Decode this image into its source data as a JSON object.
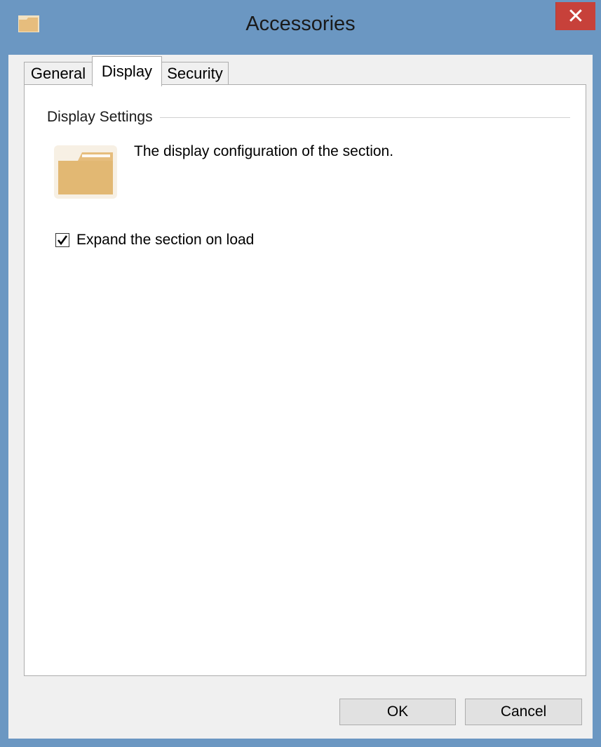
{
  "window": {
    "title": "Accessories",
    "close_symbol": "✕",
    "app_icon": "folder-icon"
  },
  "tabs": [
    {
      "label": "General",
      "active": false
    },
    {
      "label": "Display",
      "active": true
    },
    {
      "label": "Security",
      "active": false
    }
  ],
  "display_settings": {
    "group_label": "Display Settings",
    "icon": "folder-icon",
    "description": "The display configuration of the section.",
    "expand_checkbox": {
      "label": "Expand the section on load",
      "checked": true
    }
  },
  "buttons": {
    "ok_label": "OK",
    "cancel_label": "Cancel"
  },
  "colors": {
    "window_frame": "#6b97c2",
    "close_button": "#c7413a",
    "folder": "#e6bd7d"
  }
}
